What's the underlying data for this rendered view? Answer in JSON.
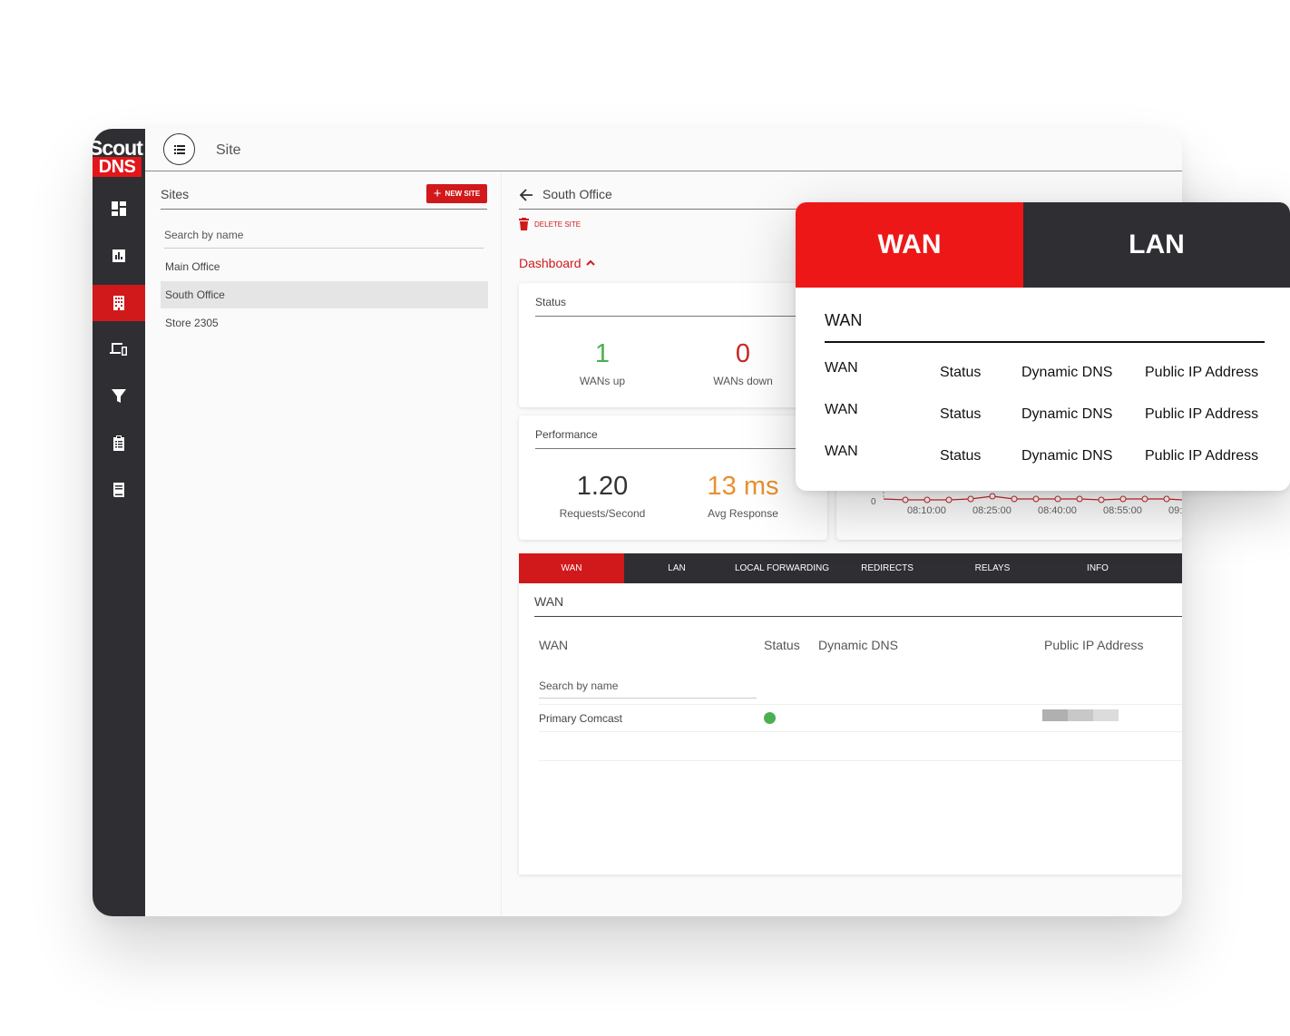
{
  "logo": {
    "line1": "Scout",
    "line2": "DNS"
  },
  "topbar": {
    "title": "Site"
  },
  "sites": {
    "header": "Sites",
    "new_site_label": "NEW SITE",
    "search_placeholder": "Search by name",
    "items": [
      {
        "label": "Main Office"
      },
      {
        "label": "South Office"
      },
      {
        "label": "Store 2305"
      }
    ]
  },
  "detail": {
    "site_name": "South Office",
    "delete_label": "DELETE SITE",
    "dashboard_label": "Dashboard",
    "status_card": {
      "title": "Status",
      "wans_up": {
        "value": "1",
        "label": "WANs up"
      },
      "wans_down": {
        "value": "0",
        "label": "WANs down"
      }
    },
    "performance_card": {
      "title": "Performance",
      "requests": {
        "value": "1.20",
        "label": "Requests/Second"
      },
      "avg_response": {
        "value": "13 ms",
        "label": "Avg Response"
      }
    },
    "chart": {
      "y_tick": "0",
      "x_ticks": [
        "08:10:00",
        "08:25:00",
        "08:40:00",
        "08:55:00",
        "09:"
      ]
    },
    "tabs": [
      "WAN",
      "LAN",
      "LOCAL FORWARDING",
      "REDIRECTS",
      "RELAYS",
      "INFO"
    ],
    "wan_card": {
      "title": "WAN",
      "columns": {
        "wan": "WAN",
        "status": "Status",
        "ddns": "Dynamic DNS",
        "ip": "Public IP Address"
      },
      "search_placeholder": "Search by name",
      "rows": [
        {
          "name": "Primary Comcast",
          "status": "up"
        }
      ]
    }
  },
  "popup": {
    "tabs": {
      "wan": "WAN",
      "lan": "LAN"
    },
    "title": "WAN",
    "rows": [
      {
        "wan": "WAN",
        "status": "Status",
        "ddns": "Dynamic DNS",
        "ip": "Public IP Address"
      },
      {
        "wan": "WAN",
        "status": "Status",
        "ddns": "Dynamic DNS",
        "ip": "Public IP Address"
      },
      {
        "wan": "WAN",
        "status": "Status",
        "ddns": "Dynamic DNS",
        "ip": "Public IP Address"
      }
    ]
  },
  "colors": {
    "accent_red": "#d1191c",
    "popup_red": "#ee1717",
    "rail_dark": "#2e2e33",
    "up_green": "#4caf50",
    "down_red": "#c62828",
    "response_orange": "#e8912f"
  }
}
